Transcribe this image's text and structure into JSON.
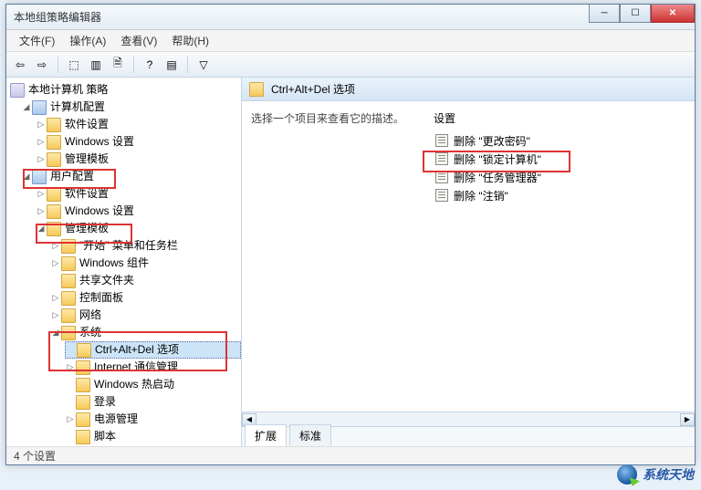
{
  "window": {
    "title": "本地组策略编辑器"
  },
  "menu": {
    "file": "文件(F)",
    "action": "操作(A)",
    "view": "查看(V)",
    "help": "帮助(H)"
  },
  "toolbar_icons": [
    "back",
    "forward",
    "up",
    "show-hide",
    "export",
    "refresh",
    "help",
    "properties",
    "filter"
  ],
  "tree": {
    "root": "本地计算机 策略",
    "computer_config": "计算机配置",
    "cc_software": "软件设置",
    "cc_windows": "Windows 设置",
    "cc_templates": "管理模板",
    "user_config": "用户配置",
    "uc_software": "软件设置",
    "uc_windows": "Windows 设置",
    "uc_templates": "管理模板",
    "start_taskbar": "\"开始\" 菜单和任务栏",
    "win_components": "Windows 组件",
    "shared_folders": "共享文件夹",
    "control_panel": "控制面板",
    "network": "网络",
    "system": "系统",
    "ctrl_alt_del": "Ctrl+Alt+Del 选项",
    "internet_comm": "Internet 通信管理",
    "win_hotstart": "Windows 热启动",
    "logon": "登录",
    "power_mgmt": "电源管理",
    "scripts": "脚本"
  },
  "right": {
    "header": "Ctrl+Alt+Del 选项",
    "description": "选择一个项目来查看它的描述。",
    "settings_label": "设置",
    "items": [
      "删除 \"更改密码\"",
      "删除 \"锁定计算机\"",
      "删除 \"任务管理器\"",
      "删除 \"注销\""
    ],
    "tabs": {
      "extended": "扩展",
      "standard": "标准"
    }
  },
  "status": {
    "text": "4 个设置"
  },
  "watermark": {
    "text": "系统天地"
  }
}
